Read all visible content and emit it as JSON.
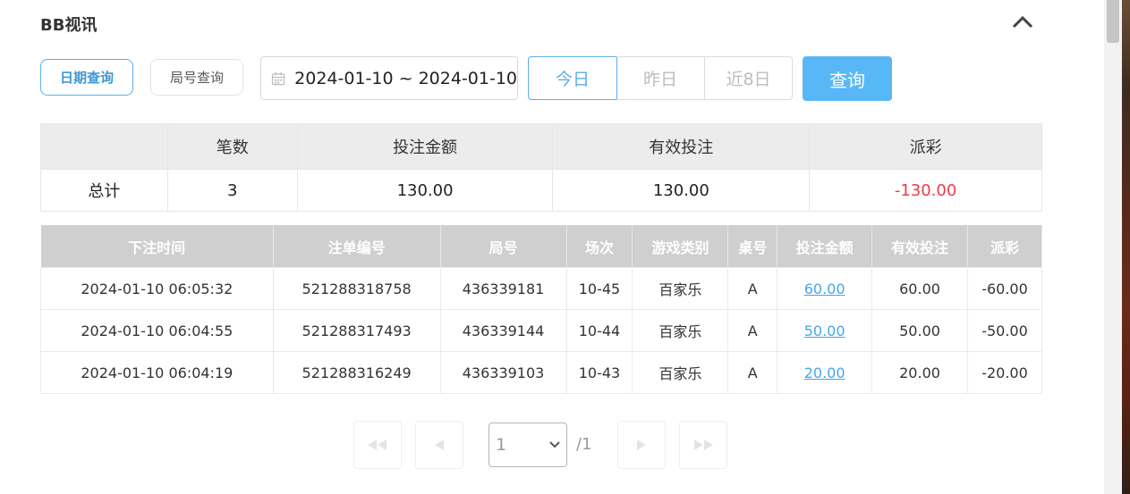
{
  "header": {
    "title": "BB视讯"
  },
  "filters": {
    "date_mode_label": "日期查询",
    "round_mode_label": "局号查询",
    "date_range": "2024-01-10 ~ 2024-01-10",
    "quick": {
      "today": "今日",
      "yesterday": "昨日",
      "last8": "近8日"
    },
    "query_label": "查询"
  },
  "summary": {
    "headers": [
      "",
      "笔数",
      "投注金额",
      "有效投注",
      "派彩"
    ],
    "row": {
      "label": "总计",
      "count": "3",
      "bet": "130.00",
      "valid": "130.00",
      "payout": "-130.00"
    }
  },
  "detail": {
    "headers": [
      "下注时间",
      "注单编号",
      "局号",
      "场次",
      "游戏类别",
      "桌号",
      "投注金额",
      "有效投注",
      "派彩"
    ],
    "rows": [
      {
        "time": "2024-01-10 06:05:32",
        "order": "521288318758",
        "round": "436339181",
        "session": "10-45",
        "game": "百家乐",
        "table": "A",
        "bet": "60.00",
        "valid": "60.00",
        "payout": "-60.00"
      },
      {
        "time": "2024-01-10 06:04:55",
        "order": "521288317493",
        "round": "436339144",
        "session": "10-44",
        "game": "百家乐",
        "table": "A",
        "bet": "50.00",
        "valid": "50.00",
        "payout": "-50.00"
      },
      {
        "time": "2024-01-10 06:04:19",
        "order": "521288316249",
        "round": "436339103",
        "session": "10-43",
        "game": "百家乐",
        "table": "A",
        "bet": "20.00",
        "valid": "20.00",
        "payout": "-20.00"
      }
    ]
  },
  "pager": {
    "current_page": "1",
    "total": "/1"
  },
  "colors": {
    "accent": "#58b8f7",
    "negative": "#ef3b48",
    "link": "#45a7e8"
  },
  "icons": {
    "collapse": "chevron-up-icon",
    "calendar": "calendar-icon",
    "first": "first-page-icon",
    "prev": "prev-page-icon",
    "next": "next-page-icon",
    "last": "last-page-icon",
    "dropdown": "chevron-down-icon"
  }
}
